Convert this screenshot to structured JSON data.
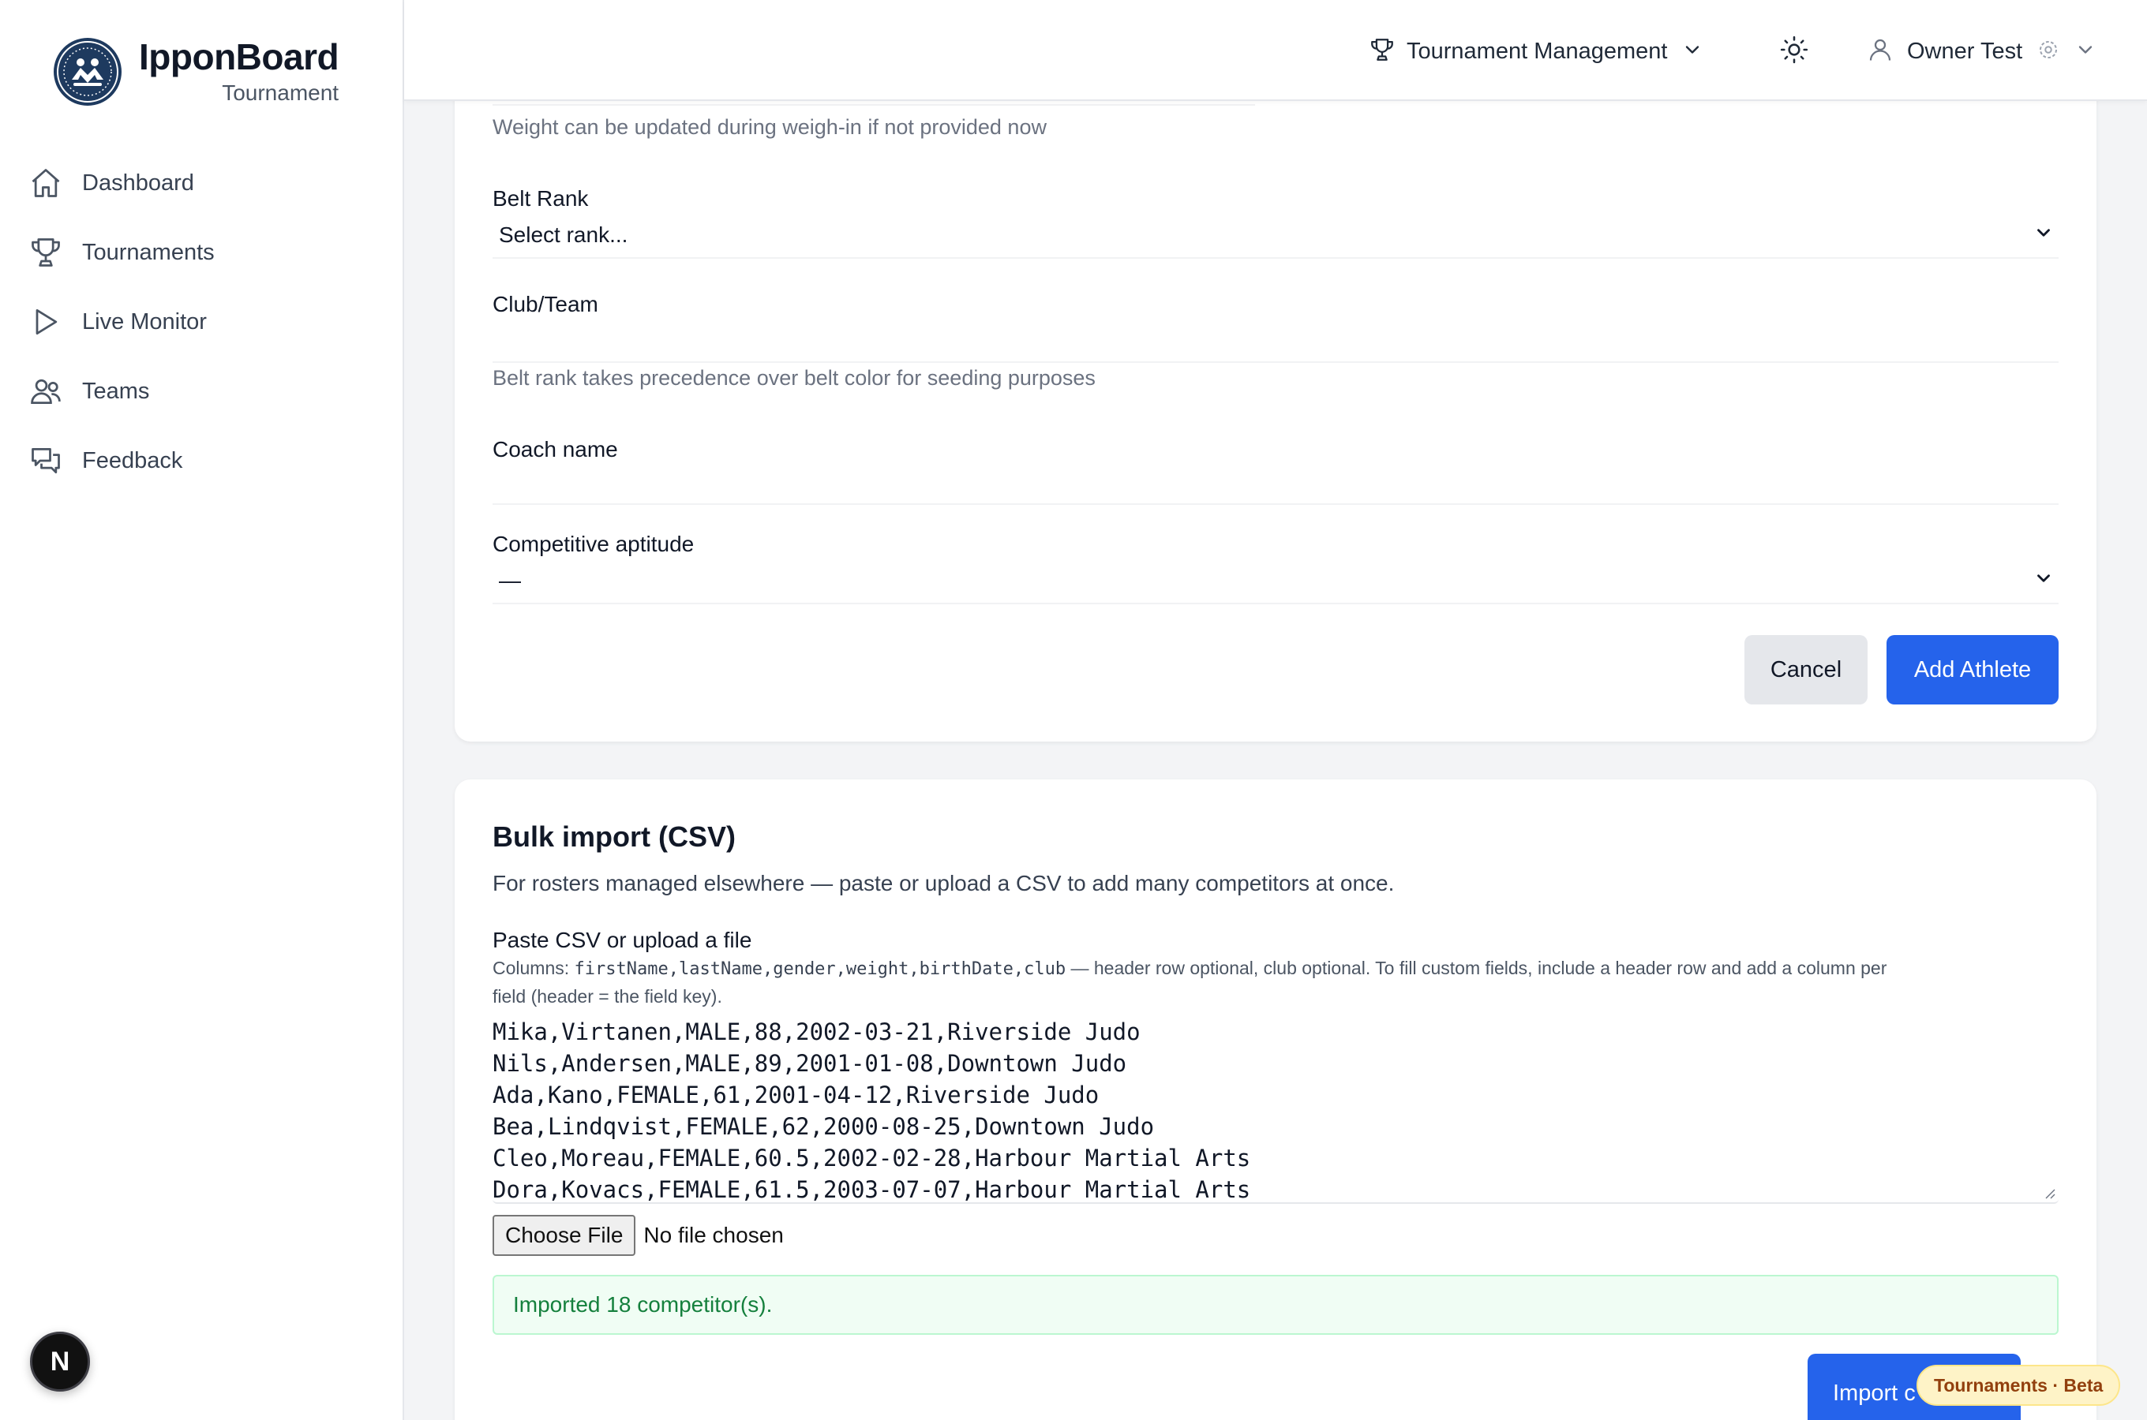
{
  "brand": {
    "name": "IpponBoard",
    "subtitle": "Tournament"
  },
  "sidebar": {
    "items": [
      {
        "label": "Dashboard",
        "icon": "home-icon"
      },
      {
        "label": "Tournaments",
        "icon": "trophy-icon"
      },
      {
        "label": "Live Monitor",
        "icon": "play-icon"
      },
      {
        "label": "Teams",
        "icon": "users-icon"
      },
      {
        "label": "Feedback",
        "icon": "chat-icon"
      }
    ]
  },
  "dev_badge": {
    "letter": "N"
  },
  "topbar": {
    "management_label": "Tournament Management",
    "user_name": "Owner Test"
  },
  "athlete_form": {
    "weight_help": "Weight can be updated during weigh-in if not provided now",
    "belt_rank": {
      "label": "Belt Rank",
      "value": "Select rank..."
    },
    "club": {
      "label": "Club/Team",
      "value": "",
      "help": "Belt rank takes precedence over belt color for seeding purposes"
    },
    "coach": {
      "label": "Coach name",
      "value": ""
    },
    "aptitude": {
      "label": "Competitive aptitude",
      "value": "—"
    },
    "cancel_label": "Cancel",
    "submit_label": "Add Athlete"
  },
  "bulk_import": {
    "title": "Bulk import (CSV)",
    "description": "For rosters managed elsewhere — paste or upload a CSV to add many competitors at once.",
    "field_label": "Paste CSV or upload a file",
    "hint_prefix": "Columns: ",
    "hint_columns": "firstName,lastName,gender,weight,birthDate,club",
    "hint_line1_suffix": " — header row optional, club optional. To fill custom fields, include a header row and add a column per",
    "hint_line2": "field (header = the field key).",
    "csv_lines": [
      "Mika,Virtanen,MALE,88,2002-03-21,Riverside Judo",
      "Nils,Andersen,MALE,89,2001-01-08,Downtown Judo",
      "Ada,Kano,FEMALE,61,2001-04-12,Riverside Judo",
      "Bea,Lindqvist,FEMALE,62,2000-08-25,Downtown Judo",
      "Cleo,Moreau,FEMALE,60.5,2002-02-28,Harbour Martial Arts",
      "Dora,Kovacs,FEMALE,61.5,2003-07-07,Harbour Martial Arts"
    ],
    "choose_file_label": "Choose File",
    "no_file_label": "No file chosen",
    "success_message": "Imported 18 competitor(s).",
    "import_button_label": "Import c"
  },
  "beta_badge": {
    "label": "Tournaments · Beta"
  },
  "colors": {
    "primary": "#2563eb",
    "success_bg": "#f0fdf4",
    "success_text": "#15803d",
    "beta_bg": "#fef3c7"
  }
}
